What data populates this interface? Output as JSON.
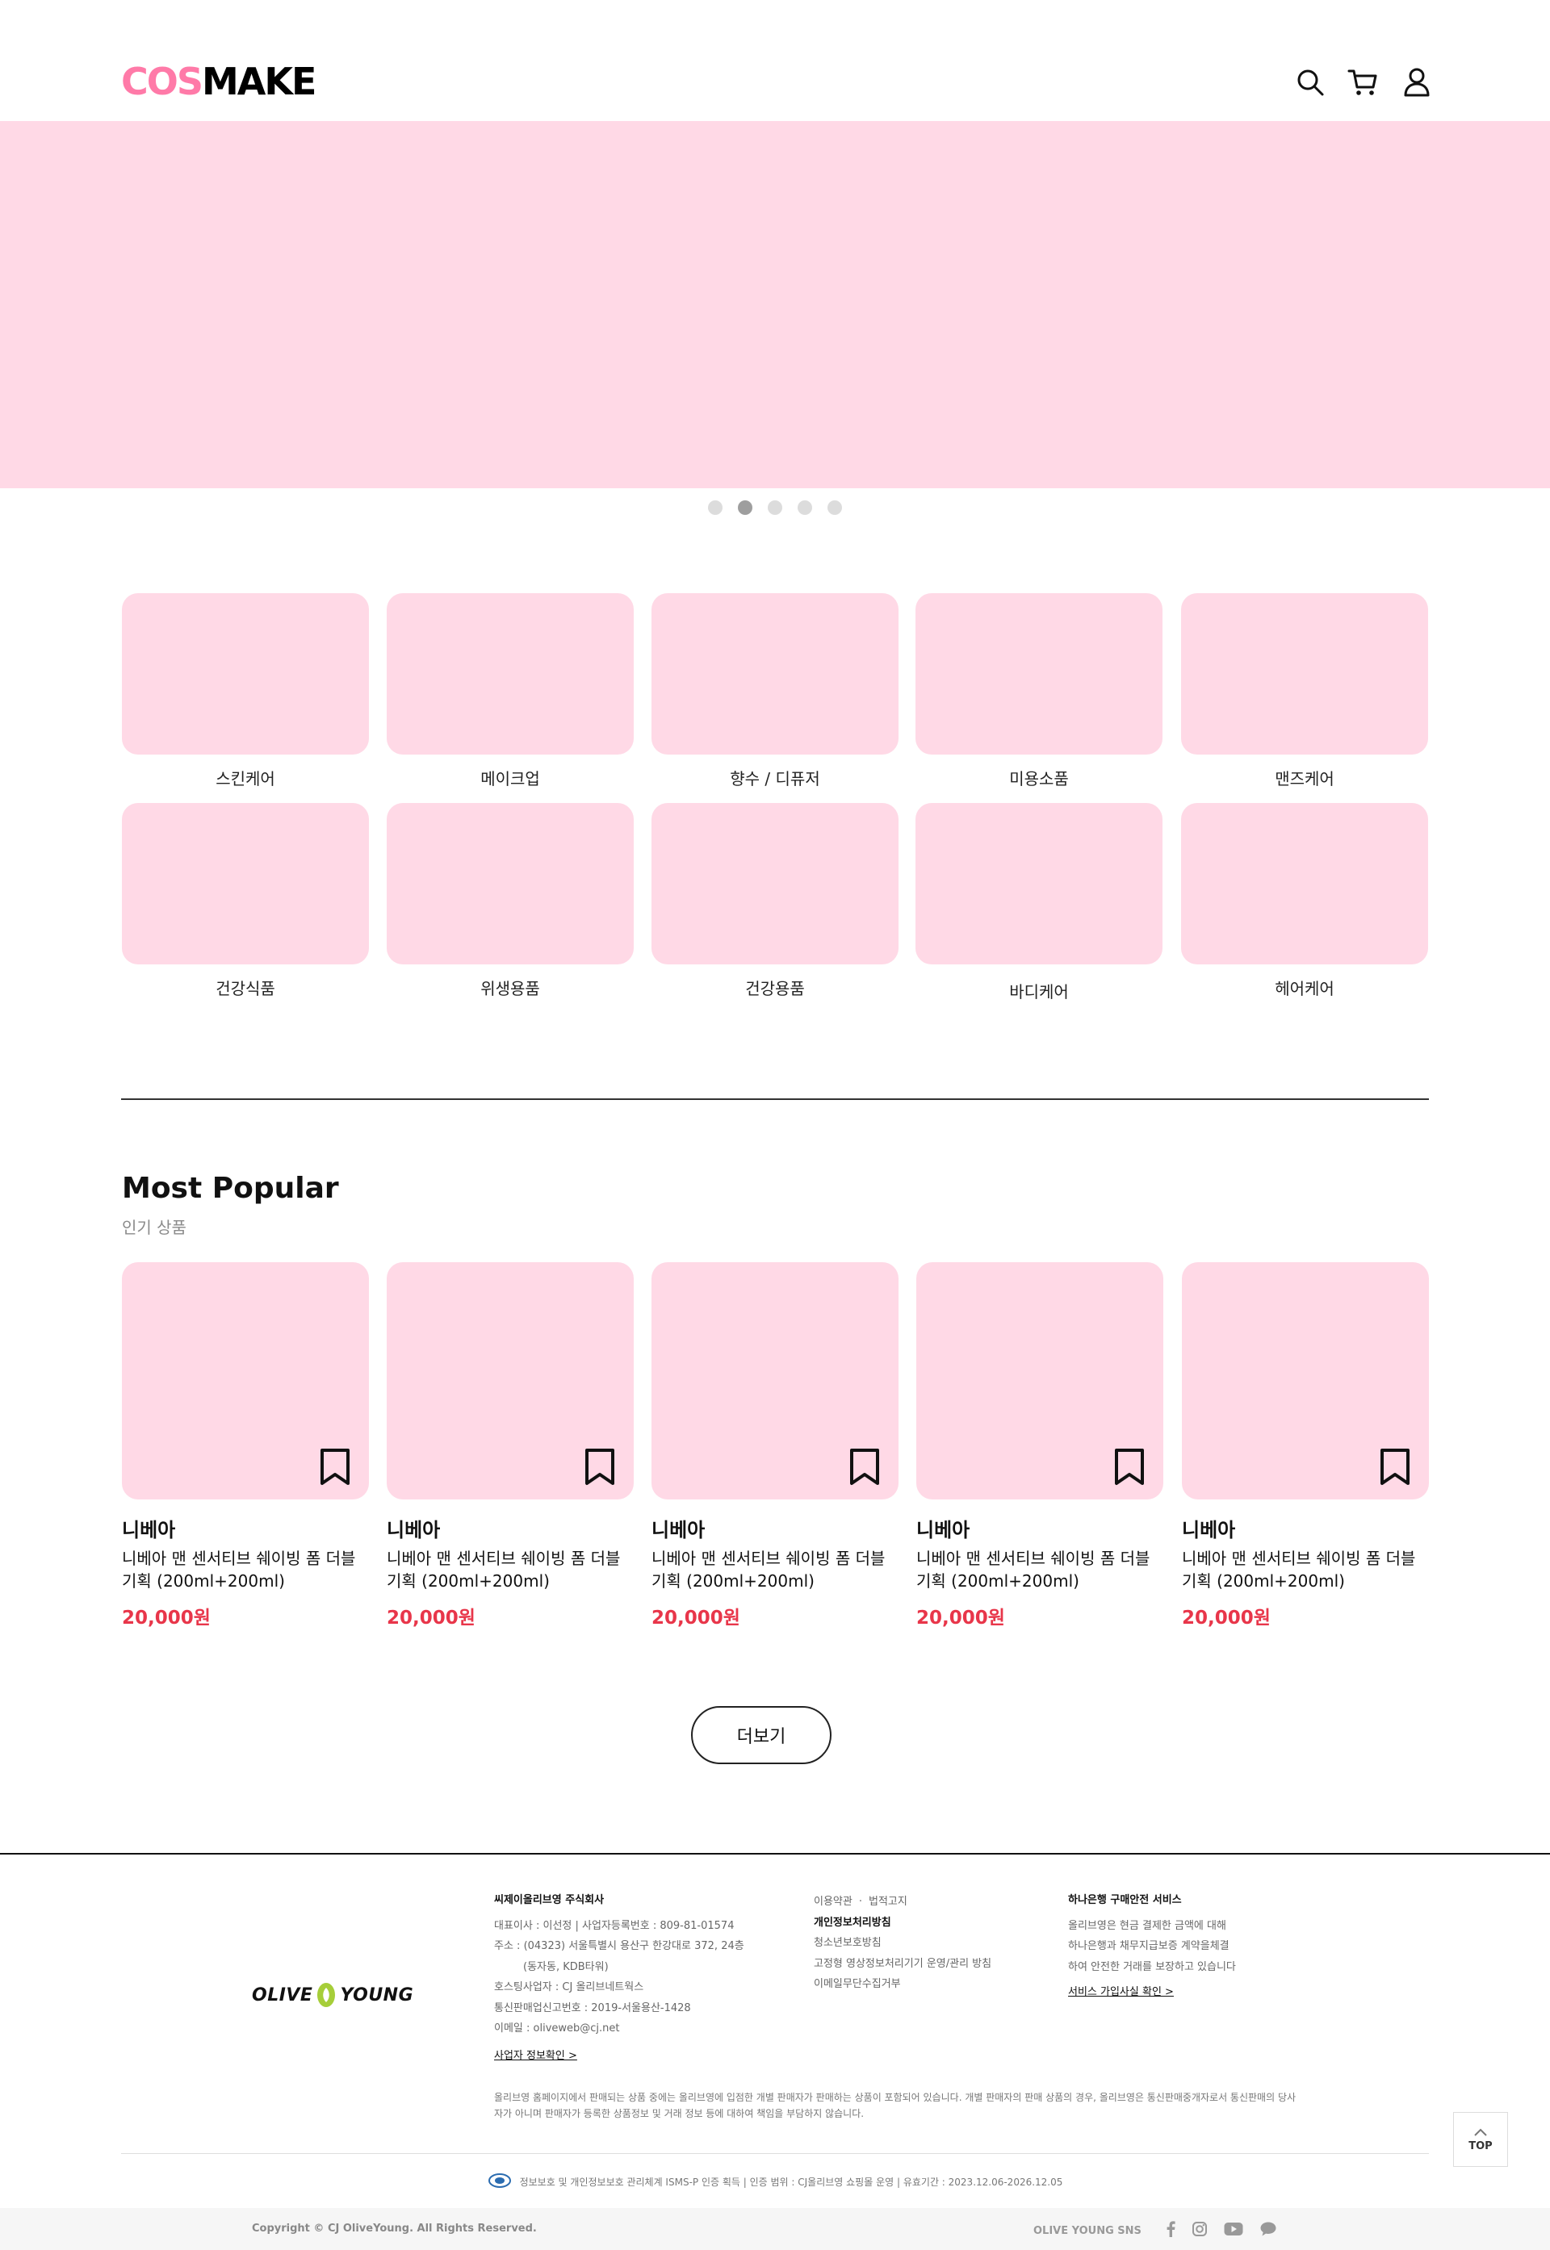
{
  "header": {
    "logo_part1": "COS",
    "logo_part2": "MAKE",
    "icons": [
      "search-icon",
      "cart-icon",
      "user-icon"
    ]
  },
  "banner": {
    "color": "#ffd9e6",
    "slide_count": 5,
    "active_slide": 2
  },
  "categories": [
    {
      "label": "스킨케어"
    },
    {
      "label": "메이크업"
    },
    {
      "label": "향수 / 디퓨저"
    },
    {
      "label": "미용소품"
    },
    {
      "label": "맨즈케어"
    },
    {
      "label": "건강식품"
    },
    {
      "label": "위생용품"
    },
    {
      "label": "건강용품"
    },
    {
      "label": "바디케어"
    },
    {
      "label": "헤어케어"
    }
  ],
  "popular": {
    "title": "Most Popular",
    "subtitle": "인기 상품",
    "products": [
      {
        "brand": "니베아",
        "name": "니베아 맨 센서티브 쉐이빙 폼 더블 기획 (200ml+200ml)",
        "price": "20,000원"
      },
      {
        "brand": "니베아",
        "name": "니베아 맨 센서티브 쉐이빙 폼 더블 기획 (200ml+200ml)",
        "price": "20,000원"
      },
      {
        "brand": "니베아",
        "name": "니베아 맨 센서티브 쉐이빙 폼 더블 기획 (200ml+200ml)",
        "price": "20,000원"
      },
      {
        "brand": "니베아",
        "name": "니베아 맨 센서티브 쉐이빙 폼 더블 기획 (200ml+200ml)",
        "price": "20,000원"
      },
      {
        "brand": "니베아",
        "name": "니베아 맨 센서티브 쉐이빙 폼 더블 기획 (200ml+200ml)",
        "price": "20,000원"
      }
    ],
    "more_label": "더보기"
  },
  "footer": {
    "logo_left": "OLIVE",
    "logo_right": "YOUNG",
    "company": {
      "title": "씨제이올리브영 주식회사",
      "lines": [
        "대표이사 : 이선정 | 사업자등록번호 : 809-81-01574",
        "주소 : (04323) 서울특별시 용산구 한강대로 372, 24층",
        "(동자동, KDB타워)",
        "호스팅사업자 : CJ 올리브네트웍스",
        "통신판매업신고번호 : 2019-서울용산-1428",
        "이메일 : oliveweb@cj.net"
      ],
      "link": "사업자 정보확인 >"
    },
    "policies": {
      "row1_a": "이용약관",
      "row1_b": "법적고지",
      "privacy": "개인정보처리방침",
      "items": [
        "청소년보호방침",
        "고정형 영상정보처리기기 운영/관리 방침",
        "이메일무단수집거부"
      ]
    },
    "bank": {
      "title": "하나은행 구매안전 서비스",
      "lines": [
        "올리브영은 현금 결제한 금액에 대해",
        "하나은행과 채무지급보증 계약을체결",
        "하여 안전한 거래를 보장하고 있습니다"
      ],
      "link": "서비스 가입사실 확인 >"
    },
    "disclaimer": "올리브영 홈페이지에서 판매되는 상품 중에는 올리브영에 입점한 개별 판매자가 판매하는 상품이 포함되어 있습니다. 개별 판매자의 판매 상품의 경우, 올리브영은 통신판매중개자로서 통신판매의 당사자가 아니며 판매자가 등록한 상품정보 및 거래 정보 등에 대하여 책임을 부담하지 않습니다.",
    "isms": "정보보호 및 개인정보보호 관리체계 ISMS-P 인증 획득  | 인증 범위 : CJ올리브영 쇼핑몰 운영  | 유효기간 : 2023.12.06-2026.12.05",
    "copyright": "Copyright © CJ OliveYoung. All Rights Reserved.",
    "sns_label": "OLIVE YOUNG SNS",
    "sns_icons": [
      "facebook-icon",
      "instagram-icon",
      "youtube-icon",
      "chat-icon"
    ],
    "top_label": "TOP"
  }
}
